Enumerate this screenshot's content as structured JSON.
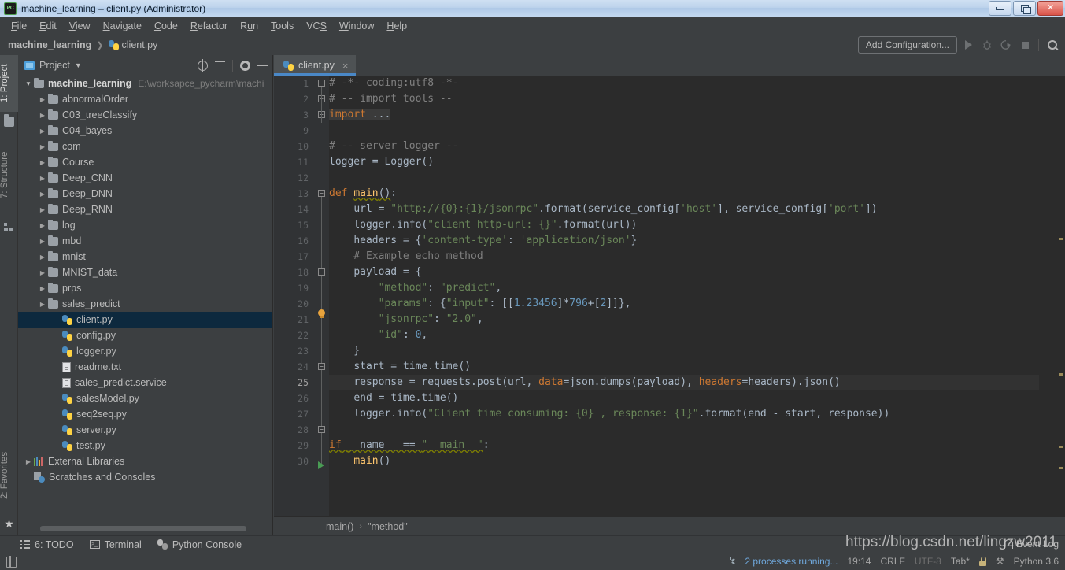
{
  "window": {
    "title": "machine_learning – client.py (Administrator)",
    "app_icon": "pycharm-icon",
    "buttons": {
      "minimize": "minimize-icon",
      "maximize": "maximize-icon",
      "close": "×"
    }
  },
  "menubar": [
    {
      "label": "File",
      "mnemonic": "F"
    },
    {
      "label": "Edit",
      "mnemonic": "E"
    },
    {
      "label": "View",
      "mnemonic": "V"
    },
    {
      "label": "Navigate",
      "mnemonic": "N"
    },
    {
      "label": "Code",
      "mnemonic": "C"
    },
    {
      "label": "Refactor",
      "mnemonic": "R"
    },
    {
      "label": "Run",
      "mnemonic": "u"
    },
    {
      "label": "Tools",
      "mnemonic": "T"
    },
    {
      "label": "VCS",
      "mnemonic": "S"
    },
    {
      "label": "Window",
      "mnemonic": "W"
    },
    {
      "label": "Help",
      "mnemonic": "H"
    }
  ],
  "navbar": {
    "project": "machine_learning",
    "separator": "❯",
    "file": "client.py",
    "add_configuration": "Add Configuration...",
    "actions": [
      "run-icon",
      "debug-icon",
      "coverage-icon",
      "stop-icon",
      "search-everywhere-icon"
    ]
  },
  "left_strip": {
    "tabs": [
      {
        "label": "1: Project",
        "active": true,
        "icon": "folder-icon"
      },
      {
        "label": "7: Structure",
        "active": false,
        "icon": "structure-icon"
      },
      {
        "label": "2: Favorites",
        "active": false,
        "icon": "star-icon"
      }
    ]
  },
  "project_panel": {
    "title": "Project",
    "actions": [
      "select-opened-file-icon",
      "collapse-all-icon",
      "settings-gear-icon",
      "hide-icon"
    ],
    "tree": [
      {
        "label": "machine_learning",
        "path": "E:\\worksapce_pycharm\\machi",
        "icon": "folder-icon",
        "arrow": "open",
        "depth": 0,
        "bold": true,
        "selected": false
      },
      {
        "label": "abnormalOrder",
        "icon": "folder-icon",
        "arrow": "closed",
        "depth": 1,
        "bold": false,
        "selected": false
      },
      {
        "label": "C03_treeClassify",
        "icon": "folder-icon",
        "arrow": "closed",
        "depth": 1,
        "bold": false,
        "selected": false
      },
      {
        "label": "C04_bayes",
        "icon": "folder-icon",
        "arrow": "closed",
        "depth": 1,
        "bold": false,
        "selected": false
      },
      {
        "label": "com",
        "icon": "folder-icon",
        "arrow": "closed",
        "depth": 1,
        "bold": false,
        "selected": false
      },
      {
        "label": "Course",
        "icon": "folder-icon",
        "arrow": "closed",
        "depth": 1,
        "bold": false,
        "selected": false
      },
      {
        "label": "Deep_CNN",
        "icon": "folder-icon",
        "arrow": "closed",
        "depth": 1,
        "bold": false,
        "selected": false
      },
      {
        "label": "Deep_DNN",
        "icon": "folder-icon",
        "arrow": "closed",
        "depth": 1,
        "bold": false,
        "selected": false
      },
      {
        "label": "Deep_RNN",
        "icon": "folder-icon",
        "arrow": "closed",
        "depth": 1,
        "bold": false,
        "selected": false
      },
      {
        "label": "log",
        "icon": "folder-icon",
        "arrow": "closed",
        "depth": 1,
        "bold": false,
        "selected": false
      },
      {
        "label": "mbd",
        "icon": "folder-icon",
        "arrow": "closed",
        "depth": 1,
        "bold": false,
        "selected": false
      },
      {
        "label": "mnist",
        "icon": "folder-icon",
        "arrow": "closed",
        "depth": 1,
        "bold": false,
        "selected": false
      },
      {
        "label": "MNIST_data",
        "icon": "folder-icon",
        "arrow": "closed",
        "depth": 1,
        "bold": false,
        "selected": false
      },
      {
        "label": "prps",
        "icon": "folder-icon",
        "arrow": "closed",
        "depth": 1,
        "bold": false,
        "selected": false
      },
      {
        "label": "sales_predict",
        "icon": "folder-icon",
        "arrow": "closed",
        "depth": 1,
        "bold": false,
        "selected": false
      },
      {
        "label": "client.py",
        "icon": "python-file-icon",
        "arrow": "none",
        "depth": 2,
        "bold": false,
        "selected": true
      },
      {
        "label": "config.py",
        "icon": "python-file-icon",
        "arrow": "none",
        "depth": 2,
        "bold": false,
        "selected": false
      },
      {
        "label": "logger.py",
        "icon": "python-file-icon",
        "arrow": "none",
        "depth": 2,
        "bold": false,
        "selected": false
      },
      {
        "label": "readme.txt",
        "icon": "text-file-icon",
        "arrow": "none",
        "depth": 2,
        "bold": false,
        "selected": false
      },
      {
        "label": "sales_predict.service",
        "icon": "text-file-icon",
        "arrow": "none",
        "depth": 2,
        "bold": false,
        "selected": false
      },
      {
        "label": "salesModel.py",
        "icon": "python-file-icon",
        "arrow": "none",
        "depth": 2,
        "bold": false,
        "selected": false
      },
      {
        "label": "seq2seq.py",
        "icon": "python-file-icon",
        "arrow": "none",
        "depth": 2,
        "bold": false,
        "selected": false
      },
      {
        "label": "server.py",
        "icon": "python-file-icon",
        "arrow": "none",
        "depth": 2,
        "bold": false,
        "selected": false
      },
      {
        "label": "test.py",
        "icon": "python-file-icon",
        "arrow": "none",
        "depth": 2,
        "bold": false,
        "selected": false
      },
      {
        "label": "External Libraries",
        "icon": "libraries-icon",
        "arrow": "closed",
        "depth": 0,
        "bold": false,
        "selected": false
      },
      {
        "label": "Scratches and Consoles",
        "icon": "scratches-icon",
        "arrow": "none",
        "depth": 0,
        "bold": false,
        "selected": false
      }
    ]
  },
  "editor": {
    "tabs": [
      {
        "label": "client.py",
        "icon": "python-file-icon",
        "active": true,
        "close": "×"
      }
    ],
    "breadcrumb": {
      "items": [
        "main()",
        "\"method\""
      ],
      "separator": "›"
    },
    "line_numbers": [
      1,
      2,
      3,
      9,
      10,
      11,
      12,
      13,
      14,
      15,
      16,
      17,
      18,
      19,
      20,
      21,
      22,
      23,
      24,
      25,
      26,
      27,
      28,
      29,
      30
    ],
    "current_line_index": 19,
    "code_lines": [
      "# -*- coding:utf8 -*-",
      "# -- import tools --",
      "import ...",
      "",
      "# -- server logger --",
      "logger = Logger()",
      "",
      "def main():",
      "    url = \"http://{0}:{1}/jsonrpc\".format(service_config['host'], service_config['port'])",
      "    logger.info(\"client http-url: {}\".format(url))",
      "    headers = {'content-type': 'application/json'}",
      "    # Example echo method",
      "    payload = {",
      "        \"method\": \"predict\",",
      "        \"params\": {\"input\": [[1.23456]*796+[2]]},",
      "        \"jsonrpc\": \"2.0\",",
      "        \"id\": 0,",
      "    }",
      "    start = time.time()",
      "    response = requests.post(url, data=json.dumps(payload), headers=headers).json()",
      "    end = time.time()",
      "    logger.info(\"Client time consuming: {0} , response: {1}\".format(end - start, response))",
      "",
      "if __name__ == \"__main__\":",
      "    main()"
    ]
  },
  "bottom_bar": [
    {
      "label": "6: TODO",
      "mnemonic": "6",
      "icon": "todo-icon"
    },
    {
      "label": "Terminal",
      "icon": "terminal-icon"
    },
    {
      "label": "Python Console",
      "icon": "python-console-icon"
    }
  ],
  "statusbar": {
    "processes": "2 processes running...",
    "time": "19:14",
    "line_separator": "CRLF",
    "encoding": "UTF-8",
    "indent": "Tab*",
    "lock": "lock-icon",
    "hammer": "hammer-icon",
    "interpreter": "Python 3.6",
    "event_log": "Event Log",
    "memory_icon": "book-icon"
  },
  "watermark": "https://blog.csdn.net/lingzw2011",
  "colors": {
    "editor_bg": "#2b2b2b",
    "panel_bg": "#3c3f41",
    "gutter_bg": "#313335",
    "selection_blue": "#0d293e",
    "tab_underline": "#4a88c7",
    "keyword": "#cc7832",
    "string": "#6a8759",
    "number": "#6897bb",
    "comment": "#808080",
    "function": "#ffc66d",
    "default_text": "#a9b7c6",
    "link_blue": "#6fa8dc",
    "run_green": "#499c54"
  }
}
